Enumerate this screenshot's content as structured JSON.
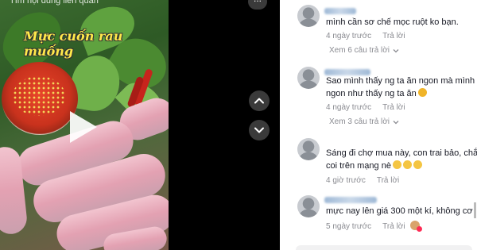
{
  "video": {
    "search_hint": "Tìm nội dung liên quan",
    "caption": "Mực cuốn rau muống",
    "play_icon": "play-icon"
  },
  "controls": {
    "more_icon": "more-icon",
    "up_icon": "chevron-up-icon",
    "down_icon": "chevron-down-icon",
    "more_label": "..."
  },
  "comments": [
    {
      "text": "mình cần sơ chế mọc ruột ko bạn.",
      "time": "4 ngày trước",
      "reply_label": "Trả lời",
      "replies_label": "Xem 6 câu trả lời"
    },
    {
      "text_line1": "Sao mình thấy ng ta ăn ngon mà mình",
      "text_line2": "ngon như thấy ng ta ăn",
      "time": "4 ngày trước",
      "reply_label": "Trả lời",
      "replies_label": "Xem 3 câu trả lời"
    },
    {
      "text_line1": "Sáng đi chợ mua này, con trai bảo, chắ",
      "text_line2": "coi trên mạng nè",
      "time": "4 giờ trước",
      "reply_label": "Trả lời"
    },
    {
      "text": "mực nay lên giá 300 một kí, không cơ",
      "time": "5 ngày trước",
      "reply_label": "Trả lời"
    }
  ],
  "colors": {
    "accent": "#fe2c55",
    "caption": "#ffe94a",
    "meta": "#8a8b91"
  }
}
